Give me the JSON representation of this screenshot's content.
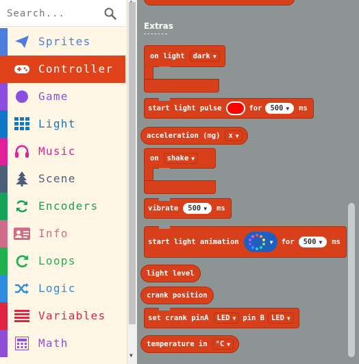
{
  "search": {
    "placeholder": "Search..."
  },
  "categories": [
    {
      "label": "Sprites",
      "color": "#4c7ee0",
      "icon": "paper-plane-icon"
    },
    {
      "label": "Controller",
      "color": "#e0421a",
      "icon": "gamepad-icon",
      "selected": true
    },
    {
      "label": "Game",
      "color": "#8a4fe0",
      "icon": "circle-icon"
    },
    {
      "label": "Light",
      "color": "#1077c8",
      "icon": "grid-icon"
    },
    {
      "label": "Music",
      "color": "#e01f9d",
      "icon": "headphones-icon"
    },
    {
      "label": "Scene",
      "color": "#4b6078",
      "icon": "tree-icon"
    },
    {
      "label": "Encoders",
      "color": "#17a25a",
      "icon": "refresh-icon"
    },
    {
      "label": "Info",
      "color": "#cf6c8a",
      "icon": "id-card-icon"
    },
    {
      "label": "Loops",
      "color": "#1fb14f",
      "icon": "loop-icon"
    },
    {
      "label": "Logic",
      "color": "#2d8ce0",
      "icon": "shuffle-icon"
    },
    {
      "label": "Variables",
      "color": "#e0233f",
      "icon": "list-icon"
    },
    {
      "label": "Math",
      "color": "#8f4ed8",
      "icon": "calculator-icon"
    }
  ],
  "flyout": {
    "heading": "Extras",
    "blocks": {
      "on_light": {
        "text": "on light",
        "dropdown": "dark"
      },
      "light_pulse": {
        "text": "start light pulse",
        "for": "for",
        "value": "500",
        "unit": "ms",
        "color": "#ff0000"
      },
      "acceleration": {
        "text": "acceleration (mg)",
        "dropdown": "x"
      },
      "on_shake": {
        "text": "on",
        "dropdown": "shake"
      },
      "vibrate": {
        "text": "vibrate",
        "value": "500",
        "unit": "ms"
      },
      "light_animation": {
        "text": "start light animation",
        "for": "for",
        "value": "500",
        "unit": "ms"
      },
      "light_level": {
        "text": "light level"
      },
      "crank_position": {
        "text": "crank position"
      },
      "set_crank": {
        "text": "set crank pinA",
        "pinA": "LED",
        "pinB_label": "pin B",
        "pinB": "LED"
      },
      "temperature": {
        "text": "temperature in",
        "dropdown": "°C"
      }
    }
  }
}
